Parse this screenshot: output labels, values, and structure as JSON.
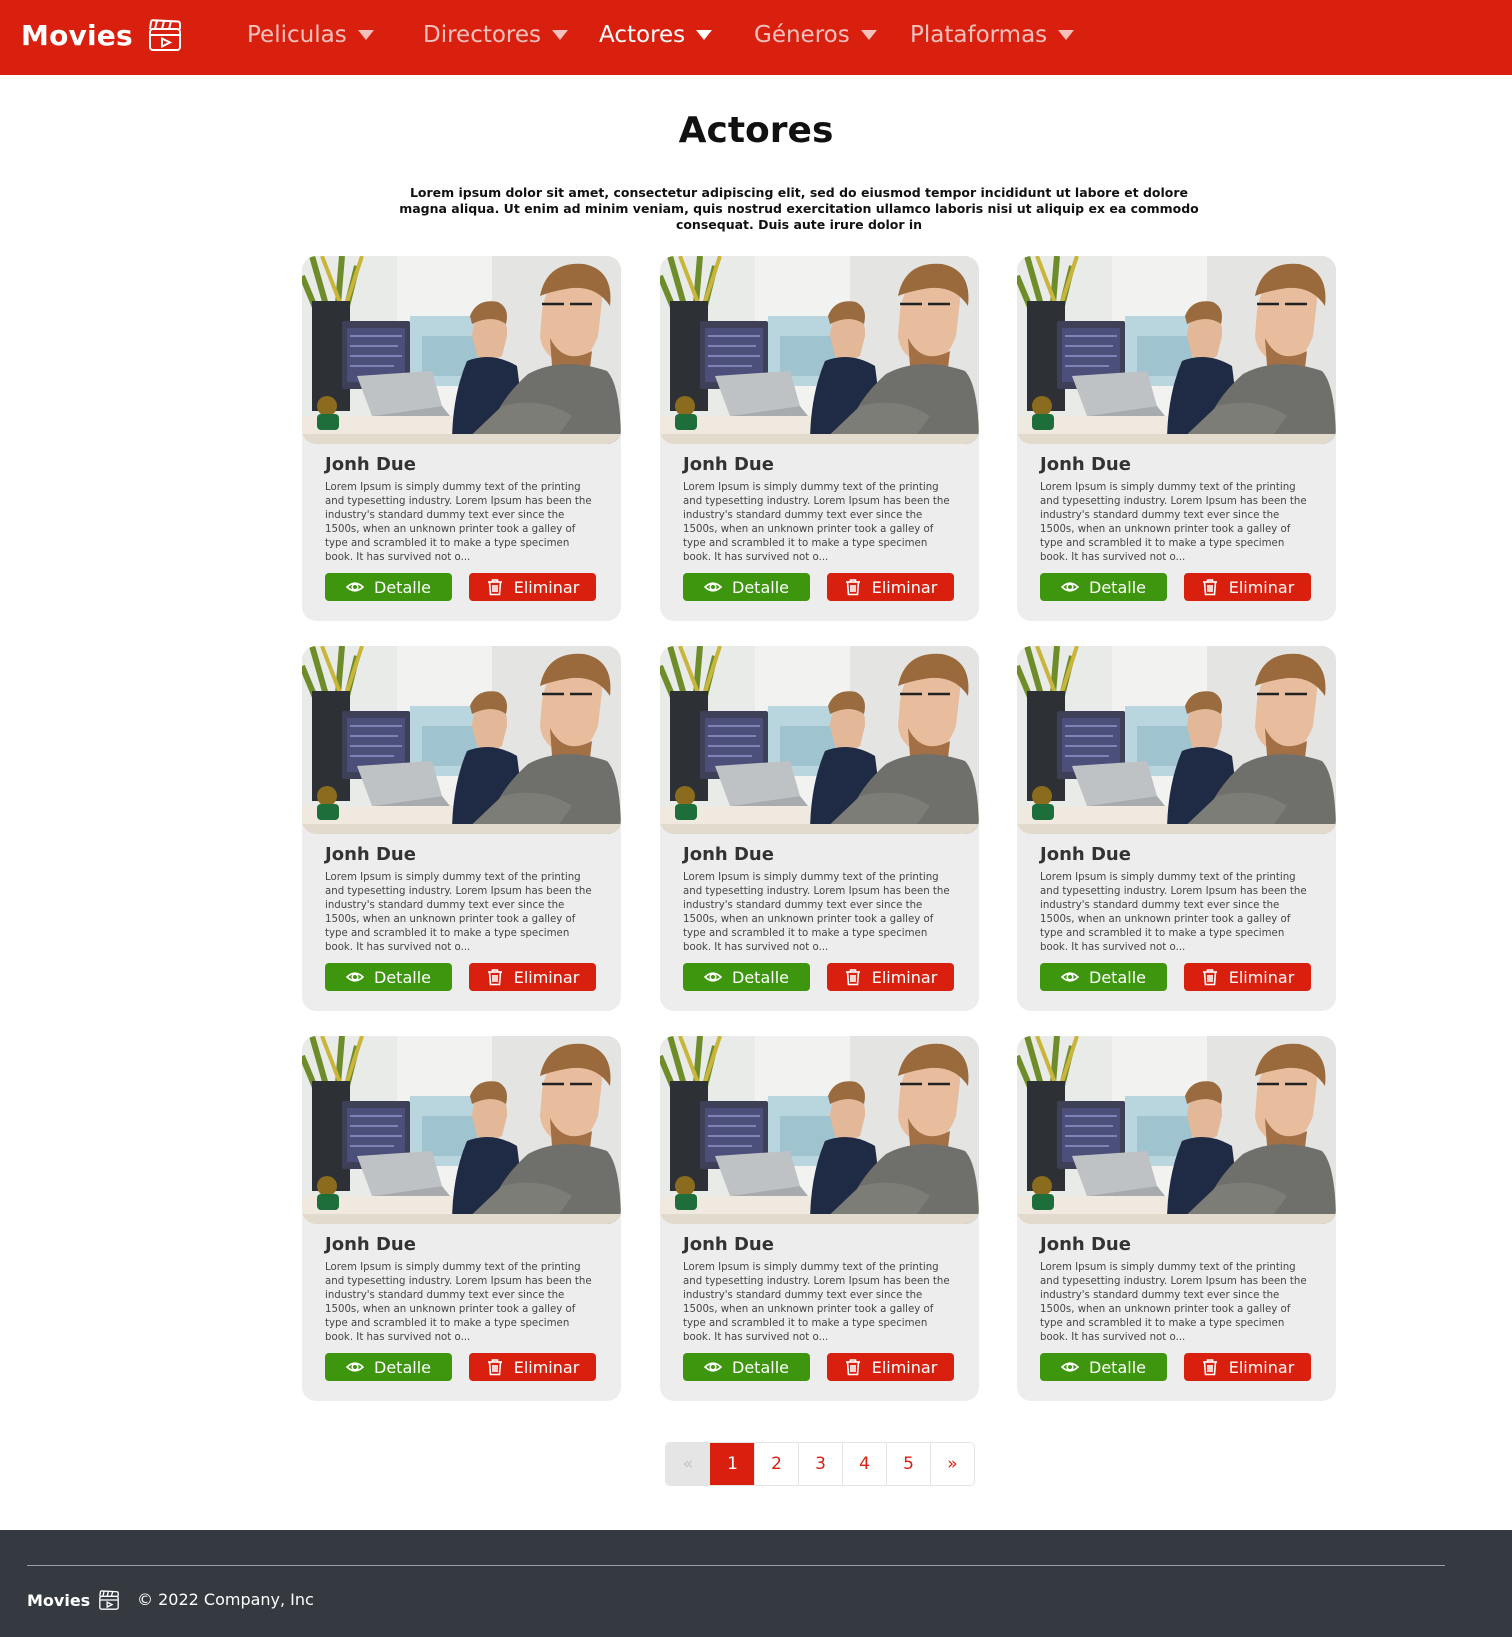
{
  "navbar": {
    "brand": "Movies",
    "brand_icon": "clapperboard-play-icon",
    "items": [
      {
        "label": "Peliculas",
        "active": false
      },
      {
        "label": "Directores",
        "active": false
      },
      {
        "label": "Actores",
        "active": true
      },
      {
        "label": "Géneros",
        "active": false
      },
      {
        "label": "Plataformas",
        "active": false
      }
    ]
  },
  "header": {
    "title": "Actores",
    "description": "Lorem ipsum dolor sit amet, consectetur adipiscing elit, sed do eiusmod tempor incididunt ut labore et dolore magna aliqua. Ut enim ad minim veniam, quis nostrud exercitation ullamco laboris nisi ut aliquip ex ea commodo consequat. Duis aute irure dolor in"
  },
  "cards": [
    {
      "name": "Jonh Due",
      "text": "Lorem Ipsum is simply dummy text of the printing and typesetting industry. Lorem Ipsum has been the industry's standard dummy text ever since the 1500s, when an unknown printer took a galley of type and scrambled it to make a type specimen book. It has survived not o...",
      "detail_label": "Detalle",
      "delete_label": "Eliminar"
    },
    {
      "name": "Jonh Due",
      "text": "Lorem Ipsum is simply dummy text of the printing and typesetting industry. Lorem Ipsum has been the industry's standard dummy text ever since the 1500s, when an unknown printer took a galley of type and scrambled it to make a type specimen book. It has survived not o...",
      "detail_label": "Detalle",
      "delete_label": "Eliminar"
    },
    {
      "name": "Jonh Due",
      "text": "Lorem Ipsum is simply dummy text of the printing and typesetting industry. Lorem Ipsum has been the industry's standard dummy text ever since the 1500s, when an unknown printer took a galley of type and scrambled it to make a type specimen book. It has survived not o...",
      "detail_label": "Detalle",
      "delete_label": "Eliminar"
    },
    {
      "name": "Jonh Due",
      "text": "Lorem Ipsum is simply dummy text of the printing and typesetting industry. Lorem Ipsum has been the industry's standard dummy text ever since the 1500s, when an unknown printer took a galley of type and scrambled it to make a type specimen book. It has survived not o...",
      "detail_label": "Detalle",
      "delete_label": "Eliminar"
    },
    {
      "name": "Jonh Due",
      "text": "Lorem Ipsum is simply dummy text of the printing and typesetting industry. Lorem Ipsum has been the industry's standard dummy text ever since the 1500s, when an unknown printer took a galley of type and scrambled it to make a type specimen book. It has survived not o...",
      "detail_label": "Detalle",
      "delete_label": "Eliminar"
    },
    {
      "name": "Jonh Due",
      "text": "Lorem Ipsum is simply dummy text of the printing and typesetting industry. Lorem Ipsum has been the industry's standard dummy text ever since the 1500s, when an unknown printer took a galley of type and scrambled it to make a type specimen book. It has survived not o...",
      "detail_label": "Detalle",
      "delete_label": "Eliminar"
    },
    {
      "name": "Jonh Due",
      "text": "Lorem Ipsum is simply dummy text of the printing and typesetting industry. Lorem Ipsum has been the industry's standard dummy text ever since the 1500s, when an unknown printer took a galley of type and scrambled it to make a type specimen book. It has survived not o...",
      "detail_label": "Detalle",
      "delete_label": "Eliminar"
    },
    {
      "name": "Jonh Due",
      "text": "Lorem Ipsum is simply dummy text of the printing and typesetting industry. Lorem Ipsum has been the industry's standard dummy text ever since the 1500s, when an unknown printer took a galley of type and scrambled it to make a type specimen book. It has survived not o...",
      "detail_label": "Detalle",
      "delete_label": "Eliminar"
    },
    {
      "name": "Jonh Due",
      "text": "Lorem Ipsum is simply dummy text of the printing and typesetting industry. Lorem Ipsum has been the industry's standard dummy text ever since the 1500s, when an unknown printer took a galley of type and scrambled it to make a type specimen book. It has survived not o...",
      "detail_label": "Detalle",
      "delete_label": "Eliminar"
    }
  ],
  "card_icons": {
    "detail": "eye-icon",
    "delete": "trash-icon",
    "photo": "actor-photo"
  },
  "pagination": {
    "prev": "«",
    "pages": [
      "1",
      "2",
      "3",
      "4",
      "5"
    ],
    "current": "1",
    "next": "»"
  },
  "footer": {
    "brand": "Movies",
    "copyright": "© 2022 Company, Inc"
  },
  "colors": {
    "brand_red": "#d9200f",
    "detail_green": "#3e960e",
    "footer_bg": "#343a40",
    "card_bg": "#ededed"
  }
}
